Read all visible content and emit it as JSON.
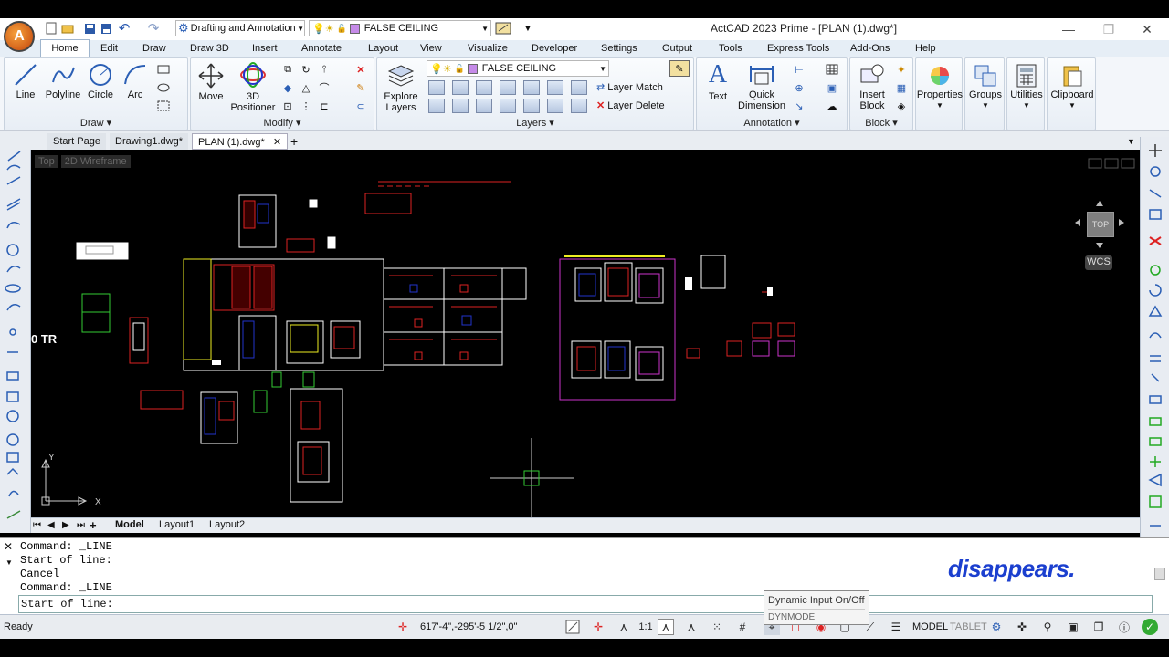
{
  "app": {
    "title": "ActCAD 2023 Prime - [PLAN (1).dwg*]",
    "logo_letter": "A"
  },
  "workspace": {
    "value": "Drafting and Annotation"
  },
  "layer_current": "FALSE CEILING",
  "menu": [
    "Home",
    "Edit",
    "Draw",
    "Draw 3D",
    "Insert",
    "Annotate",
    "Layout",
    "View",
    "Visualize",
    "Developer",
    "Settings",
    "Output",
    "Tools",
    "Express Tools",
    "Add-Ons",
    "Help"
  ],
  "ribbon": {
    "draw": {
      "title": "Draw",
      "line": "Line",
      "polyline": "Polyline",
      "circle": "Circle",
      "arc": "Arc"
    },
    "modify": {
      "title": "Modify",
      "move": "Move",
      "positioner_1": "3D",
      "positioner_2": "Positioner"
    },
    "layers": {
      "title": "Layers",
      "explore_1": "Explore",
      "explore_2": "Layers",
      "layer_match": "Layer Match",
      "layer_delete": "Layer Delete"
    },
    "annotation": {
      "title": "Annotation",
      "text": "Text",
      "qd_1": "Quick",
      "qd_2": "Dimension"
    },
    "block": {
      "title": "Block",
      "insert_1": "Insert",
      "insert_2": "Block"
    },
    "properties": "Properties",
    "groups": "Groups",
    "utilities": "Utilities",
    "clipboard": "Clipboard"
  },
  "doc_tabs": [
    "Start Page",
    "Drawing1.dwg*",
    "PLAN (1).dwg*"
  ],
  "viewport": {
    "view": "Top",
    "style": "2D Wireframe",
    "cube_label": "TOP",
    "ucs_label": "WCS",
    "partial_text": "0 TR",
    "axis_x": "X",
    "axis_y": "Y"
  },
  "layout_tabs": [
    "Model",
    "Layout1",
    "Layout2"
  ],
  "command": {
    "history": [
      "Command: _LINE",
      "Start of line:",
      "Cancel",
      "Command: _LINE"
    ],
    "prompt": "Start of line:"
  },
  "watermark": "disappears.",
  "tooltip": {
    "title": "Dynamic Input On/Off",
    "command": "DYNMODE"
  },
  "status": {
    "ready": "Ready",
    "coordinates": "617'-4\",-295'-5 1/2\",0\"",
    "scale": "1:1",
    "model": "MODEL",
    "tablet": "TABLET"
  },
  "colors": {
    "accent": "#1b3fcf",
    "layer_swatch": "#c58ae8",
    "canvas": "#000000"
  }
}
